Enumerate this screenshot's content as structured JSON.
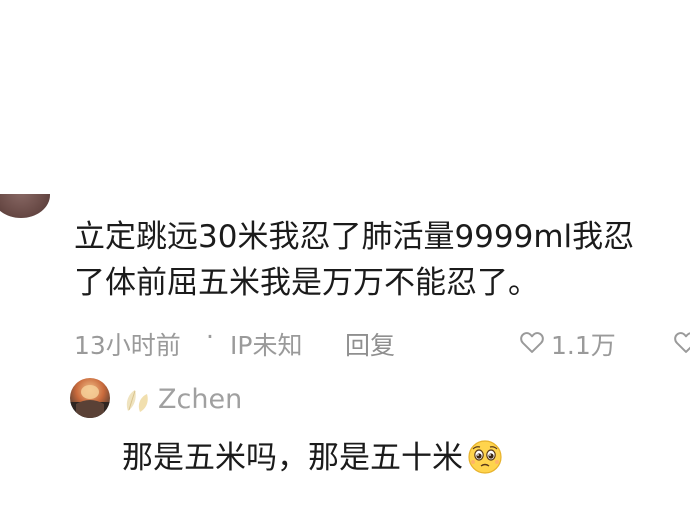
{
  "comment": {
    "line1": "立定跳远30米我忍了肺活量9999ml我忍",
    "line2": "了体前屈五米我是万万不能忍了。",
    "time": "13小时前",
    "separator": "·",
    "ip": "IP未知",
    "reply_label": "回复",
    "like_count": "1.1万",
    "icons": [
      "heart-outline-icon",
      "dislike-icon"
    ]
  },
  "reply": {
    "username": "Zchen",
    "text": "那是五米吗，那是五十米",
    "emoji": "pleading-face-emoji",
    "badge": "leaf-badge-icon"
  }
}
